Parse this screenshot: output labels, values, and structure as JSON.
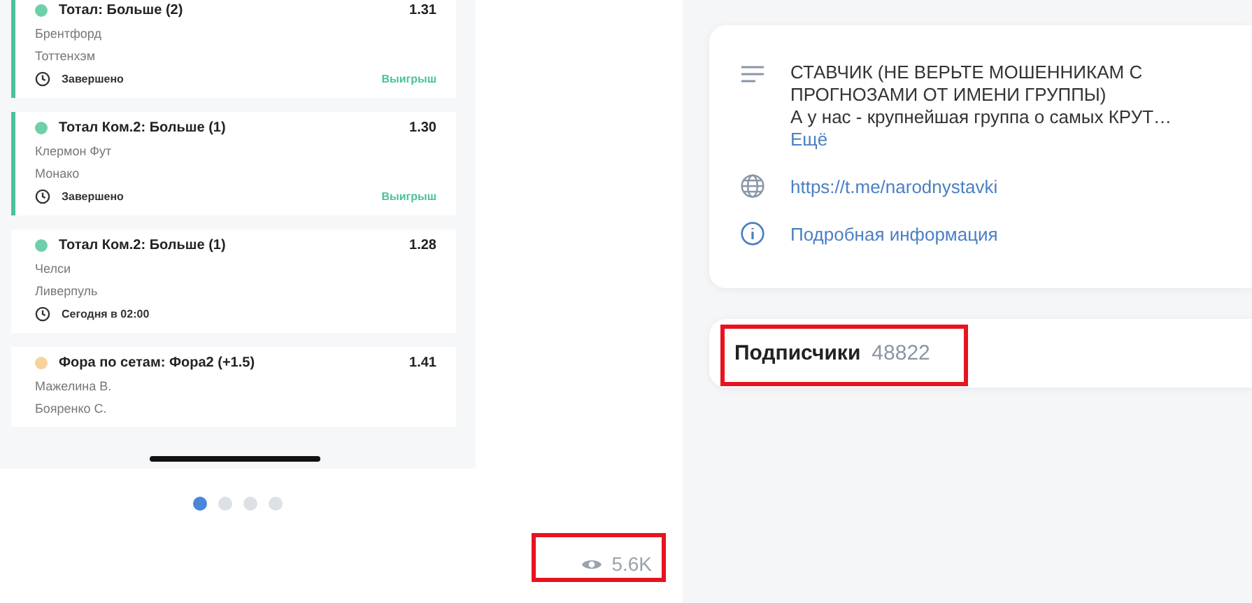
{
  "post": {
    "bets": [
      {
        "market": "Тотал: Больше (2)",
        "odds": "1.31",
        "teams": [
          "Брентфорд",
          "Тоттенхэм"
        ],
        "time": "Завершено",
        "result": "Выигрыш",
        "color": "#6fcfa8",
        "accent": true
      },
      {
        "market": "Тотал Ком.2: Больше (1)",
        "odds": "1.30",
        "teams": [
          "Клермон Фут",
          "Монако"
        ],
        "time": "Завершено",
        "result": "Выигрыш",
        "color": "#6fcfa8",
        "accent": true
      },
      {
        "market": "Тотал Ком.2: Больше (1)",
        "odds": "1.28",
        "teams": [
          "Челси",
          "Ливерпуль"
        ],
        "time": "Сегодня в 02:00",
        "color": "#6fcfa8",
        "accent": false
      },
      {
        "market": "Фора по сетам: Фора2 (+1.5)",
        "odds": "1.41",
        "teams": [
          "Мажелина В.",
          "Бояренко С."
        ],
        "color": "#f7d29a",
        "accent": false
      }
    ],
    "carousel": [
      {
        "selected": true
      },
      {
        "selected": false
      },
      {
        "selected": false
      },
      {
        "selected": false
      }
    ],
    "views": "5.6K"
  },
  "group": {
    "description_title": "СТАВЧИК (НЕ ВЕРЬТЕ МОШЕННИКАМ С ПРОГНОЗАМИ ОТ ИМЕНИ ГРУППЫ)",
    "description_text": "А у нас - крупнейшая группа о самых КРУТ…",
    "more": "Ещё",
    "link": "https://t.me/narodnystavki",
    "details": "Подробная информация",
    "subscribers_label": "Подписчики",
    "subscribers_count": "48822"
  }
}
